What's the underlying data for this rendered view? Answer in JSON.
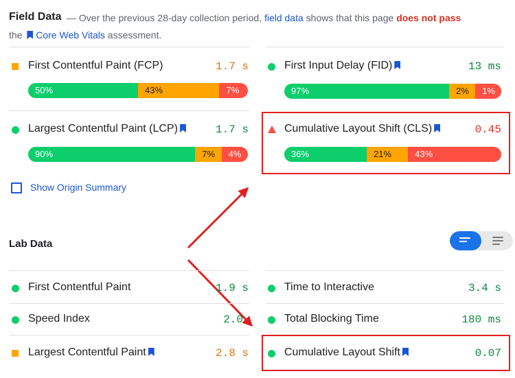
{
  "field": {
    "title": "Field Data",
    "intro_dash": "—",
    "intro_before": "Over the previous 28-day collection period,",
    "intro_link": "field data",
    "intro_middle": "shows that this page",
    "intro_fail": "does not pass",
    "intro_the": "the",
    "intro_cwv_link": "Core Web Vitals",
    "intro_end": "assessment.",
    "metrics": [
      {
        "label": "First Contentful Paint (FCP)",
        "value": "1.7 s",
        "status": "average",
        "segments": [
          "50%",
          "43%",
          "7%"
        ]
      },
      {
        "label": "First Input Delay (FID)",
        "value": "13 ms",
        "status": "good",
        "segments": [
          "97%",
          "2%",
          "1%"
        ]
      },
      {
        "label": "Largest Contentful Paint (LCP)",
        "value": "1.7 s",
        "status": "good",
        "segments": [
          "90%",
          "7%",
          "4%"
        ]
      },
      {
        "label": "Cumulative Layout Shift (CLS)",
        "value": "0.45",
        "status": "poor",
        "segments": [
          "36%",
          "21%",
          "43%"
        ]
      }
    ],
    "origin_summary_label": "Show Origin Summary"
  },
  "lab": {
    "title": "Lab Data",
    "metrics": [
      {
        "label": "First Contentful Paint",
        "value": "1.9 s",
        "status": "good"
      },
      {
        "label": "Time to Interactive",
        "value": "3.4 s",
        "status": "good"
      },
      {
        "label": "Speed Index",
        "value": "2.0",
        "status": "good"
      },
      {
        "label": "Total Blocking Time",
        "value": "180 ms",
        "status": "good"
      },
      {
        "label": "Largest Contentful Paint",
        "value": "2.8 s",
        "status": "average"
      },
      {
        "label": "Cumulative Layout Shift",
        "value": "0.07",
        "status": "good"
      }
    ]
  },
  "colors": {
    "good": "#0cce6b",
    "average": "#ffa400",
    "poor": "#ff4e42",
    "link": "#1a56d6",
    "highlight": "#e31e1e",
    "toggle_active": "#1a73e8"
  }
}
